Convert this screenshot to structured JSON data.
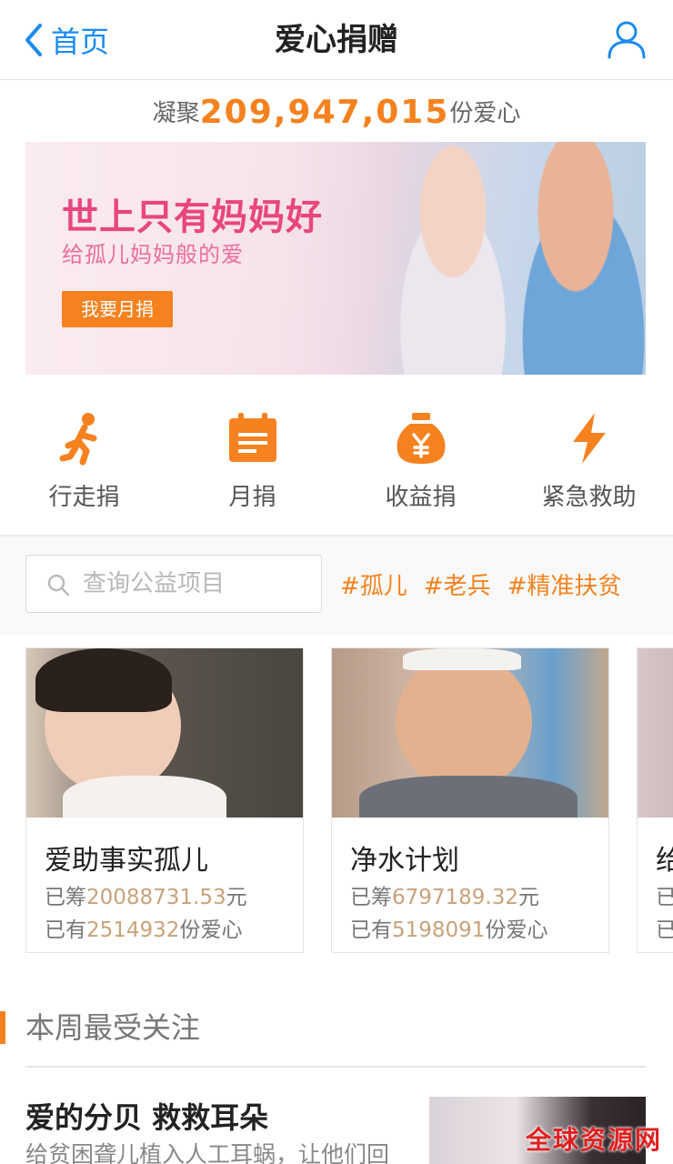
{
  "nav": {
    "back_label": "首页",
    "title": "爱心捐赠"
  },
  "counter": {
    "prefix": "凝聚",
    "number": "209,947,015",
    "suffix": "份爱心"
  },
  "banner": {
    "title": "世上只有妈妈好",
    "subtitle": "给孤儿妈妈般的爱",
    "button": "我要月捐"
  },
  "quick_actions": [
    {
      "label": "行走捐",
      "icon": "walking-person-icon"
    },
    {
      "label": "月捐",
      "icon": "calendar-icon"
    },
    {
      "label": "收益捐",
      "icon": "money-bag-yen-icon"
    },
    {
      "label": "紧急救助",
      "icon": "lightning-icon"
    }
  ],
  "search": {
    "placeholder": "查询公益项目"
  },
  "tags": [
    "#孤儿",
    "#老兵",
    "#精准扶贫"
  ],
  "projects": [
    {
      "name": "爱助事实孤儿",
      "raised_prefix": "已筹",
      "raised": "20088731.53",
      "raised_unit": "元",
      "count_prefix": "已有",
      "count": "2514932",
      "count_unit": "份爱心"
    },
    {
      "name": "净水计划",
      "raised_prefix": "已筹",
      "raised": "6797189.32",
      "raised_unit": "元",
      "count_prefix": "已有",
      "count": "5198091",
      "count_unit": "份爱心"
    },
    {
      "name": "给",
      "raised_prefix": "已",
      "count_prefix": "已"
    }
  ],
  "weekly": {
    "title": "本周最受关注",
    "article": {
      "title": "爱的分贝 救救耳朵",
      "desc": "给贫困聋儿植入人工耳蜗，让他们回"
    }
  },
  "watermark": "全球资源网",
  "colors": {
    "accent": "#f5821f",
    "link": "#1a8cf0",
    "banner_title": "#e8467d",
    "amount": "#c9a27a"
  }
}
